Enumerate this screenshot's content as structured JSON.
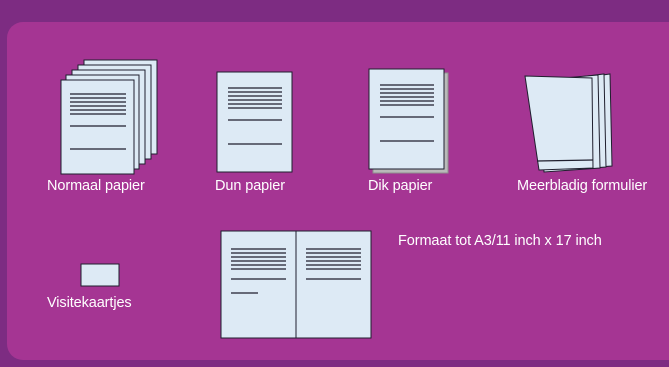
{
  "items": {
    "normaal": "Normaal papier",
    "dun": "Dun papier",
    "dik": "Dik papier",
    "meerbladig": "Meerbladig formulier",
    "visitekaartjes": "Visitekaartjes"
  },
  "format_note": "Formaat tot A3/11 inch x 17 inch",
  "colors": {
    "background": "#7d2c82",
    "panel": "#a53593",
    "paper": "#ddeaf5",
    "paper_shadow": "#b9b9b9",
    "outline": "#1f1f2e",
    "text": "#ffffff"
  }
}
